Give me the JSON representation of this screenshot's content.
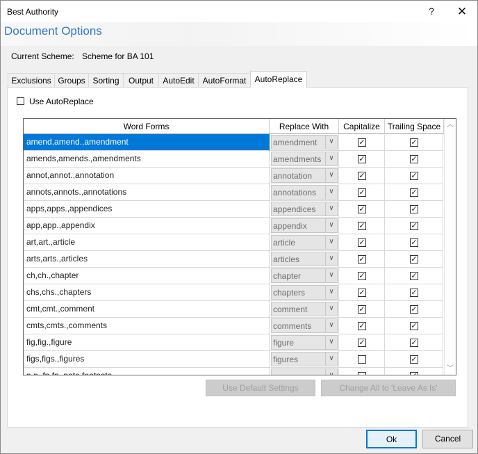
{
  "window": {
    "title": "Best Authority",
    "help_label": "?",
    "close_label": "✕"
  },
  "header": {
    "title": "Document Options",
    "scheme_label": "Current Scheme:",
    "scheme_value": "Scheme for BA 101"
  },
  "tabs": [
    {
      "label": "Exclusions",
      "active": false
    },
    {
      "label": "Groups",
      "active": false
    },
    {
      "label": "Sorting",
      "active": false
    },
    {
      "label": "Output",
      "active": false
    },
    {
      "label": "AutoEdit",
      "active": false
    },
    {
      "label": "AutoFormat",
      "active": false
    },
    {
      "label": "AutoReplace",
      "active": true
    }
  ],
  "use_autoreplace": {
    "label": "Use AutoReplace",
    "checked": false
  },
  "grid": {
    "columns": [
      "Word Forms",
      "Replace With",
      "Capitalize",
      "Trailing Space"
    ],
    "rows": [
      {
        "word_forms": "amend,amend.,amendment",
        "replace_with": "amendment",
        "capitalize": true,
        "trailing_space": true,
        "selected": true
      },
      {
        "word_forms": "amends,amends.,amendments",
        "replace_with": "amendments",
        "capitalize": true,
        "trailing_space": true
      },
      {
        "word_forms": "annot,annot.,annotation",
        "replace_with": "annotation",
        "capitalize": true,
        "trailing_space": true
      },
      {
        "word_forms": "annots,annots.,annotations",
        "replace_with": "annotations",
        "capitalize": true,
        "trailing_space": true
      },
      {
        "word_forms": "apps,apps.,appendices",
        "replace_with": "appendices",
        "capitalize": true,
        "trailing_space": true
      },
      {
        "word_forms": "app,app.,appendix",
        "replace_with": "appendix",
        "capitalize": true,
        "trailing_space": true
      },
      {
        "word_forms": "art,art.,article",
        "replace_with": "article",
        "capitalize": true,
        "trailing_space": true
      },
      {
        "word_forms": "arts,arts.,articles",
        "replace_with": "articles",
        "capitalize": true,
        "trailing_space": true
      },
      {
        "word_forms": "ch,ch.,chapter",
        "replace_with": "chapter",
        "capitalize": true,
        "trailing_space": true
      },
      {
        "word_forms": "chs,chs.,chapters",
        "replace_with": "chapters",
        "capitalize": true,
        "trailing_space": true
      },
      {
        "word_forms": "cmt,cmt.,comment",
        "replace_with": "comment",
        "capitalize": true,
        "trailing_space": true
      },
      {
        "word_forms": "cmts,cmts.,comments",
        "replace_with": "comments",
        "capitalize": true,
        "trailing_space": true
      },
      {
        "word_forms": "fig,fig.,figure",
        "replace_with": "figure",
        "capitalize": true,
        "trailing_space": true
      },
      {
        "word_forms": "figs,figs.,figures",
        "replace_with": "figures",
        "capitalize": false,
        "trailing_space": true
      },
      {
        "word_forms": "n,n.,fn,fn.,note,footnote",
        "replace_with": "",
        "capitalize": false,
        "trailing_space": true
      }
    ]
  },
  "buttons": {
    "use_default": "Use Default Settings",
    "change_all": "Change All to 'Leave As Is'",
    "ok": "Ok",
    "cancel": "Cancel"
  }
}
